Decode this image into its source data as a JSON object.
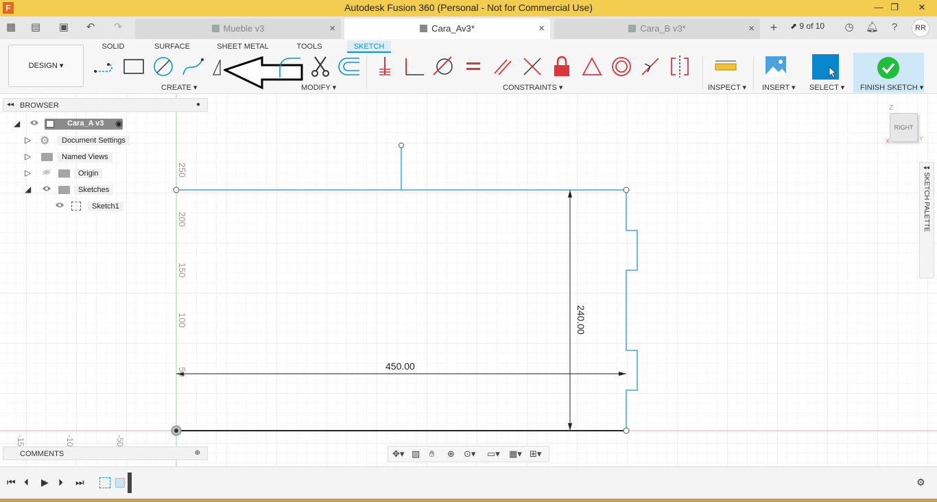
{
  "app": {
    "title": "Autodesk Fusion 360 (Personal - Not for Commercial Use)",
    "icon_letter": "F",
    "window_controls": [
      "—",
      "❐",
      "✕"
    ]
  },
  "tabs": [
    {
      "label": "Mueble v3",
      "active": false
    },
    {
      "label": "Cara_Av3*",
      "active": true
    },
    {
      "label": "Cara_B v3*",
      "active": false
    }
  ],
  "header_right": {
    "version_counter": "9 of 10",
    "user_initials": "RR"
  },
  "toolbar": {
    "workspace": "DESIGN",
    "tabs": [
      "SOLID",
      "SURFACE",
      "SHEET METAL",
      "TOOLS",
      "SKETCH"
    ],
    "active_tab": "SKETCH",
    "groups": {
      "create": "CREATE",
      "modify": "MODIFY",
      "constraints": "CONSTRAINTS",
      "inspect": "INSPECT",
      "insert": "INSERT",
      "select": "SELECT",
      "finish": "FINISH SKETCH"
    }
  },
  "browser": {
    "title": "BROWSER",
    "root": "Cara_A v3",
    "items": [
      {
        "label": "Document Settings",
        "icon": "gear-icon"
      },
      {
        "label": "Named Views",
        "icon": "folder-icon"
      },
      {
        "label": "Origin",
        "icon": "folder-icon"
      },
      {
        "label": "Sketches",
        "icon": "folder-icon"
      },
      {
        "label": "Sketch1",
        "icon": "sketch-icon"
      }
    ]
  },
  "comments": {
    "title": "COMMENTS"
  },
  "canvas": {
    "dimension_horizontal": "450.00",
    "dimension_vertical": "240.00",
    "ruler_y": [
      "250",
      "200",
      "150",
      "100",
      "50"
    ],
    "ruler_x": [
      "-15",
      "-10",
      "-50"
    ]
  },
  "viewcube": {
    "face": "RIGHT",
    "axis_z": "Z",
    "axis_y": "Y",
    "axis_x": "X"
  },
  "sketch_palette": {
    "label": "SKETCH PALETTE"
  },
  "colors": {
    "titlebar": "#f2cd4f",
    "accent": "#0696d7",
    "sketch_line": "#5bb4e0",
    "finish_green": "#1fbf3a",
    "constraint_red": "#d9363e"
  }
}
